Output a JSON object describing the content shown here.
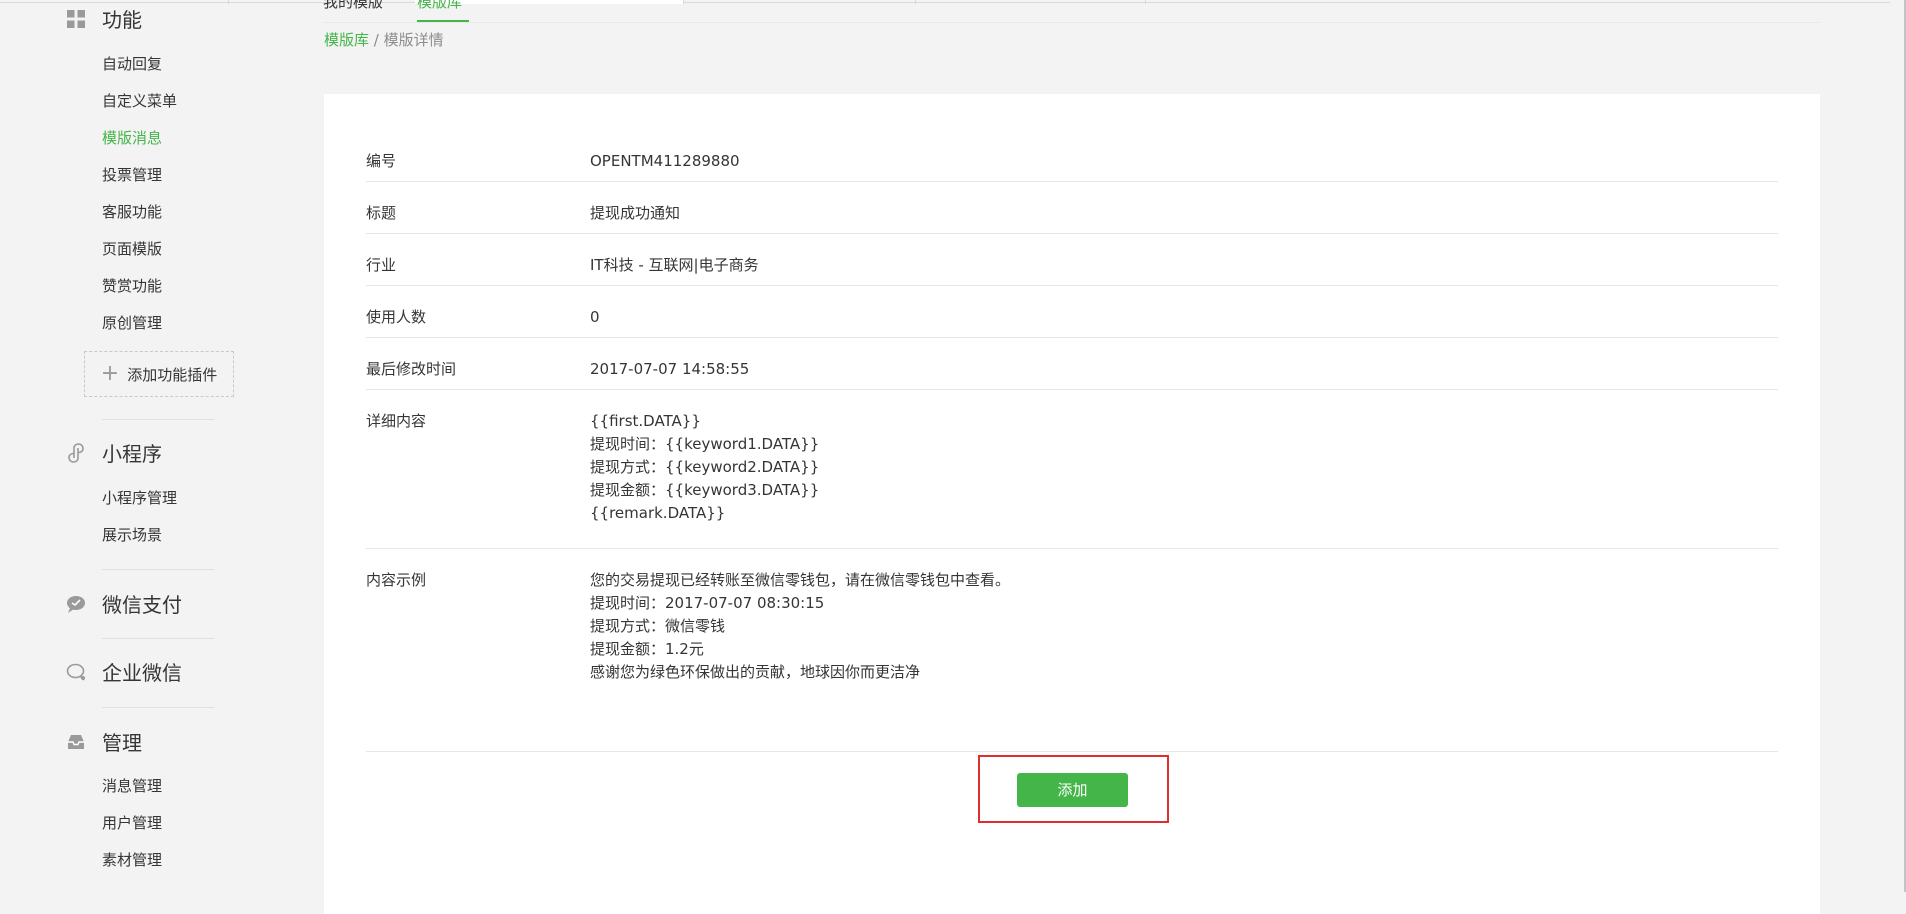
{
  "colors": {
    "accent": "#44b549",
    "highlight": "#e02d2d",
    "text": "#353535",
    "muted": "#8d8d8d",
    "background": "#f3f3f3"
  },
  "sidebar": {
    "sections": [
      {
        "title": "功能",
        "icon": "grid-icon",
        "items": [
          {
            "label": "自动回复",
            "active": false
          },
          {
            "label": "自定义菜单",
            "active": false
          },
          {
            "label": "模版消息",
            "active": true
          },
          {
            "label": "投票管理",
            "active": false
          },
          {
            "label": "客服功能",
            "active": false
          },
          {
            "label": "页面模版",
            "active": false
          },
          {
            "label": "赞赏功能",
            "active": false
          },
          {
            "label": "原创管理",
            "active": false
          }
        ],
        "add_plugin": "添加功能插件"
      },
      {
        "title": "小程序",
        "icon": "link-icon",
        "items": [
          {
            "label": "小程序管理",
            "active": false
          },
          {
            "label": "展示场景",
            "active": false
          }
        ]
      },
      {
        "title": "微信支付",
        "icon": "chat-bubble-icon",
        "items": []
      },
      {
        "title": "企业微信",
        "icon": "chat-outline-icon",
        "items": []
      },
      {
        "title": "管理",
        "icon": "inbox-icon",
        "items": [
          {
            "label": "消息管理",
            "active": false
          },
          {
            "label": "用户管理",
            "active": false
          },
          {
            "label": "素材管理",
            "active": false
          }
        ]
      }
    ]
  },
  "tabs": {
    "mine": "我的模版",
    "library": "模版库"
  },
  "breadcrumb": {
    "parent": "模版库",
    "separator": "/",
    "current": "模版详情"
  },
  "detail": {
    "rows": [
      {
        "label": "编号",
        "lines": [
          "OPENTM411289880"
        ]
      },
      {
        "label": "标题",
        "lines": [
          "提现成功通知"
        ]
      },
      {
        "label": "行业",
        "lines": [
          "IT科技 - 互联网|电子商务"
        ]
      },
      {
        "label": "使用人数",
        "lines": [
          "0"
        ]
      },
      {
        "label": "最后修改时间",
        "lines": [
          "2017-07-07 14:58:55"
        ]
      },
      {
        "label": "详细内容",
        "lines": [
          "{{first.DATA}}",
          "提现时间：{{keyword1.DATA}}",
          "提现方式：{{keyword2.DATA}}",
          "提现金额：{{keyword3.DATA}}",
          "{{remark.DATA}}"
        ]
      },
      {
        "label": "内容示例",
        "lines": [
          "您的交易提现已经转账至微信零钱包，请在微信零钱包中查看。",
          "提现时间：2017-07-07 08:30:15",
          "提现方式：微信零钱",
          "提现金额：1.2元",
          "感谢您为绿色环保做出的贡献，地球因你而更洁净"
        ]
      }
    ]
  },
  "actions": {
    "add_label": "添加"
  }
}
